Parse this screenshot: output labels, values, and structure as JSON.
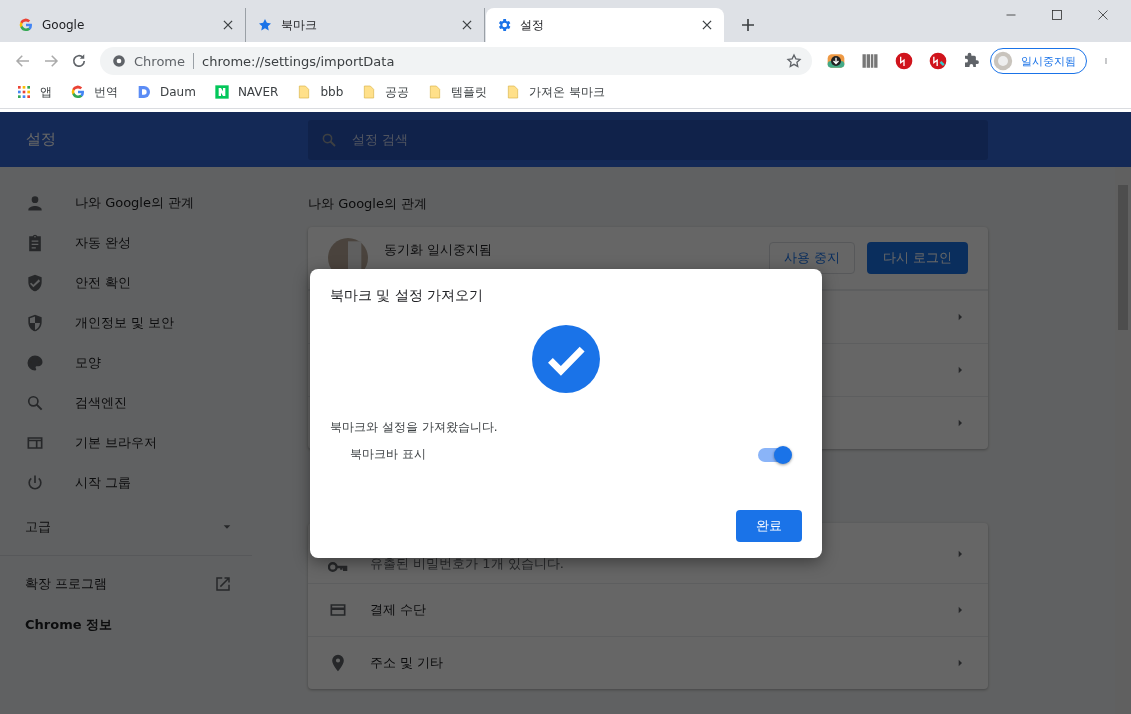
{
  "tabs": [
    {
      "title": "Google",
      "selected": false
    },
    {
      "title": "북마크",
      "selected": false
    },
    {
      "title": "설정",
      "selected": true
    }
  ],
  "toolbar": {
    "site_label": "Chrome",
    "url": "chrome://settings/importData",
    "profile": "일시중지됨"
  },
  "bookmarks": [
    {
      "label": "앱",
      "kind": "apps"
    },
    {
      "label": "번역",
      "kind": "google"
    },
    {
      "label": "Daum",
      "kind": "daum"
    },
    {
      "label": "NAVER",
      "kind": "naver"
    },
    {
      "label": "bbb",
      "kind": "folder"
    },
    {
      "label": "공공",
      "kind": "folder"
    },
    {
      "label": "템플릿",
      "kind": "folder"
    },
    {
      "label": "가져온 북마크",
      "kind": "folder"
    }
  ],
  "header": {
    "title": "설정",
    "search_placeholder": "설정 검색"
  },
  "sidebar": {
    "items": [
      {
        "label": "나와 Google의 관계"
      },
      {
        "label": "자동 완성"
      },
      {
        "label": "안전 확인"
      },
      {
        "label": "개인정보 및 보안"
      },
      {
        "label": "모양"
      },
      {
        "label": "검색엔진"
      },
      {
        "label": "기본 브라우저"
      },
      {
        "label": "시작 그룹"
      }
    ],
    "advanced": "고급",
    "extensions": "확장 프로그램",
    "about": "Chrome 정보"
  },
  "main": {
    "section_title": "나와 Google의 관계",
    "sync": {
      "status": "동기화 일시중지됨",
      "stop_button": "사용 중지",
      "login_button": "다시 로그인"
    },
    "card1_rows": [
      {
        "kind": "arrow"
      },
      {
        "kind": "arrow"
      },
      {
        "kind": "arrow"
      }
    ],
    "card2_rows": [
      {
        "kind": "subtitle",
        "text": "유출된 비밀번호가 1개 있습니다."
      },
      {
        "kind": "title",
        "text": "결제 수단"
      },
      {
        "kind": "title",
        "text": "주소 및 기타"
      }
    ]
  },
  "dialog": {
    "title": "북마크 및 설정 가져오기",
    "message": "북마크와 설정을 가져왔습니다.",
    "toggle": {
      "label": "북마크바 표시",
      "on": true
    },
    "done_button": "완료"
  }
}
